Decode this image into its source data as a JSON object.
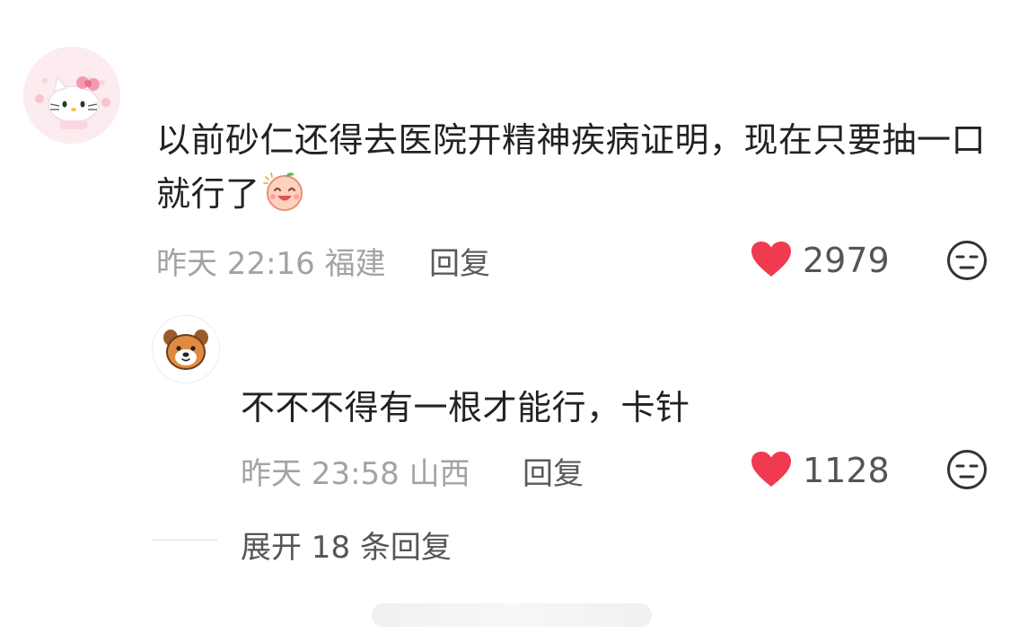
{
  "comment": {
    "avatar_icon": "hello-kitty-avatar-icon",
    "text": "以前砂仁还得去医院开精神疾病证明，现在只要抽一口就行了",
    "emoji_icon": "laughing-face-emoji-icon",
    "time": "昨天 22:16",
    "location": "福建",
    "reply_label": "回复",
    "like_count": "2979",
    "heart_icon": "heart-icon",
    "dislike_icon": "dislike-face-icon"
  },
  "reply": {
    "avatar_icon": "dog-avatar-icon",
    "text": "不不不得有一根才能行，卡针",
    "time": "昨天 23:58",
    "location": "山西",
    "reply_label": "回复",
    "like_count": "1128",
    "heart_icon": "heart-icon",
    "dislike_icon": "dislike-face-icon"
  },
  "expand": {
    "label": "展开 18 条回复"
  },
  "colors": {
    "heart": "#f03a4f",
    "meta_gray": "#a3a3a3",
    "text": "#222222"
  }
}
